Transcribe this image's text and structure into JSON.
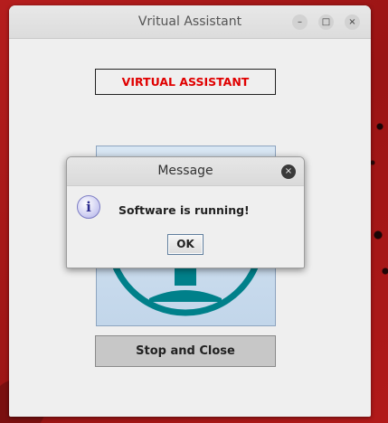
{
  "window": {
    "title": "Vritual Assistant",
    "controls": {
      "minimize": "–",
      "maximize": "□",
      "close": "×"
    }
  },
  "main": {
    "heading_label": "VIRTUAL ASSISTANT",
    "heading_color": "#e00000",
    "image_icon": "assistant-avatar-icon",
    "stop_button_label": "Stop and Close"
  },
  "dialog": {
    "title": "Message",
    "close_glyph": "×",
    "icon": "info-icon",
    "icon_glyph": "i",
    "message": "Software is running!",
    "ok_label": "OK"
  },
  "colors": {
    "avatar": "#00808a",
    "desktop": "#a01818"
  }
}
